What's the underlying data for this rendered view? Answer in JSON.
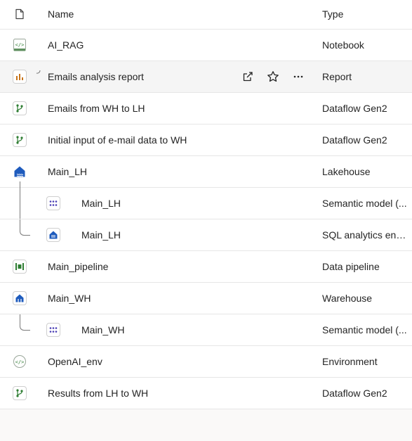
{
  "header": {
    "name_label": "Name",
    "type_label": "Type"
  },
  "rows": [
    {
      "name": "AI_RAG",
      "type": "Notebook",
      "icon": "notebook-icon"
    },
    {
      "name": "Emails analysis report",
      "type": "Report",
      "icon": "report-icon"
    },
    {
      "name": "Emails from WH to LH",
      "type": "Dataflow Gen2",
      "icon": "dataflow-icon"
    },
    {
      "name": "Initial input of e-mail data to WH",
      "type": "Dataflow Gen2",
      "icon": "dataflow-icon"
    },
    {
      "name": "Main_LH",
      "type": "Lakehouse",
      "icon": "lakehouse-icon"
    },
    {
      "name": "Main_LH",
      "type": "Semantic model (...",
      "icon": "semantic-model-icon"
    },
    {
      "name": "Main_LH",
      "type": "SQL analytics end...",
      "icon": "sql-endpoint-icon"
    },
    {
      "name": "Main_pipeline",
      "type": "Data pipeline",
      "icon": "pipeline-icon"
    },
    {
      "name": "Main_WH",
      "type": "Warehouse",
      "icon": "warehouse-icon"
    },
    {
      "name": "Main_WH",
      "type": "Semantic model (...",
      "icon": "semantic-model-icon"
    },
    {
      "name": "OpenAI_env",
      "type": "Environment",
      "icon": "environment-icon"
    },
    {
      "name": "Results from LH to WH",
      "type": "Dataflow Gen2",
      "icon": "dataflow-icon"
    }
  ],
  "colors": {
    "green": "#2e7d32",
    "blue": "#1e5bbd",
    "orange": "#c8741a"
  }
}
